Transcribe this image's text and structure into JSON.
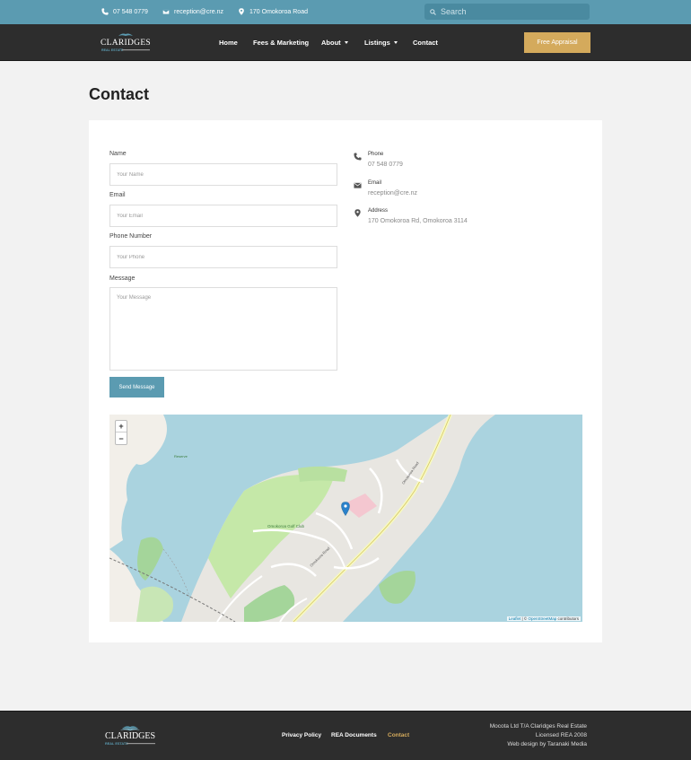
{
  "topbar": {
    "phone": "07 548 0779",
    "email": "reception@cre.nz",
    "address": "170 Omokoroa Road",
    "search_placeholder": "Search"
  },
  "nav": {
    "logo_text": "CLARIDGES",
    "logo_sub": "REAL ESTATE",
    "items": [
      {
        "label": "Home"
      },
      {
        "label": "Fees & Marketing"
      },
      {
        "label": "About"
      },
      {
        "label": "Listings"
      },
      {
        "label": "Contact"
      }
    ],
    "cta": "Free Appraisal"
  },
  "page": {
    "title": "Contact"
  },
  "form": {
    "name_label": "Name",
    "name_placeholder": "Your Name",
    "email_label": "Email",
    "email_placeholder": "Your Email",
    "phone_label": "Phone Number",
    "phone_placeholder": "Your Phone",
    "message_label": "Message",
    "message_placeholder": "Your Message",
    "submit": "Send Message"
  },
  "contact_info": {
    "phone_title": "Phone",
    "phone_value": "07 548 0779",
    "email_title": "Email",
    "email_value": "reception@cre.nz",
    "address_title": "Address",
    "address_value": "170 Omokoroa Rd, Omokoroa 3114"
  },
  "map": {
    "zoom_in": "+",
    "zoom_out": "−",
    "attr_leaflet": "Leaflet",
    "attr_sep": " | © ",
    "attr_osm": "OpenStreetMap",
    "attr_tail": " contributors",
    "label_golf": "Omokoroa Golf Club",
    "label_road": "Omokoroa Road",
    "label_rd2": "Omokoroa Road",
    "label_reserve": "Reserve"
  },
  "footer": {
    "logo_text": "CLARIDGES",
    "logo_sub": "REAL ESTATE",
    "links": [
      {
        "label": "Privacy Policy"
      },
      {
        "label": "REA Documents"
      },
      {
        "label": "Contact"
      }
    ],
    "line1": "Mocota Ltd T/A Claridges Real Estate",
    "line2": "Licensed REA 2008",
    "line3": "Web design by Taranaki Media"
  },
  "colors": {
    "accent": "#5b9bb1",
    "gold": "#d4aa5c",
    "dark": "#2d2d2d"
  }
}
